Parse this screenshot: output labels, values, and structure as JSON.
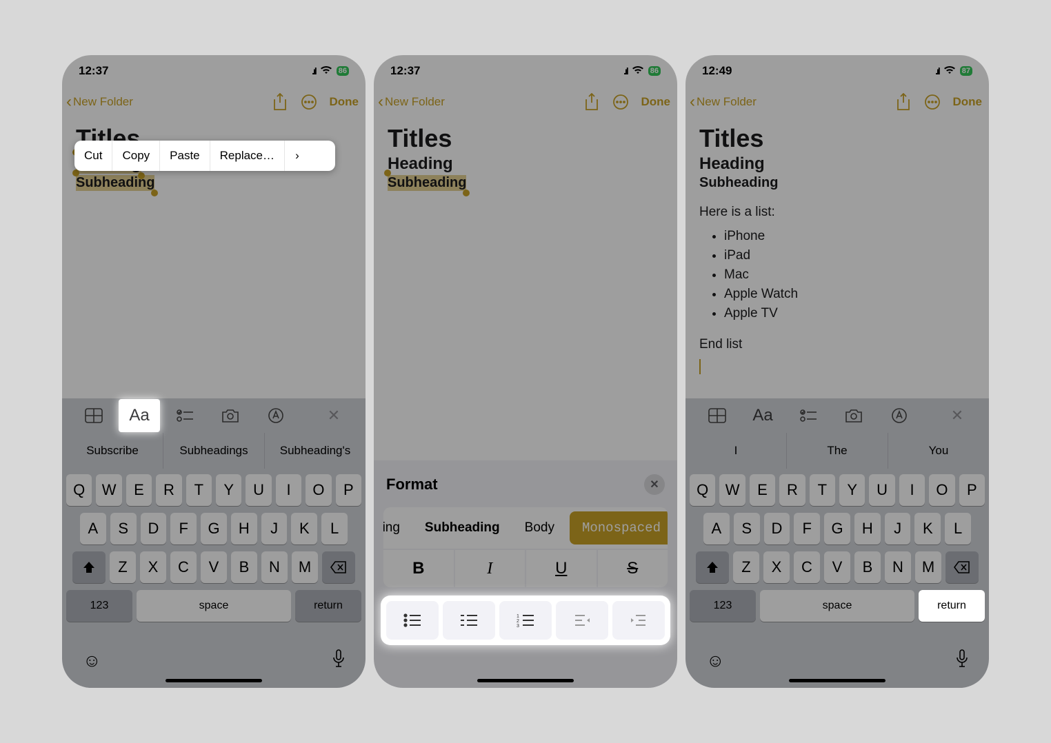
{
  "screens": [
    {
      "time": "12:37",
      "battery": "86",
      "back": "New Folder",
      "done": "Done",
      "note": {
        "title": "Titles",
        "heading": "Heading",
        "subheading": "Subheading"
      },
      "popover": [
        "Cut",
        "Copy",
        "Paste",
        "Replace…"
      ],
      "toolbar_highlight": "Aa",
      "suggestions": [
        "Subscribe",
        "Subheadings",
        "Subheading's"
      ],
      "keyboard": {
        "row1": [
          "Q",
          "W",
          "E",
          "R",
          "T",
          "Y",
          "U",
          "I",
          "O",
          "P"
        ],
        "row2": [
          "A",
          "S",
          "D",
          "F",
          "G",
          "H",
          "J",
          "K",
          "L"
        ],
        "row3": [
          "Z",
          "X",
          "C",
          "V",
          "B",
          "N",
          "M"
        ],
        "k123": "123",
        "space": "space",
        "ret": "return"
      }
    },
    {
      "time": "12:37",
      "battery": "86",
      "back": "New Folder",
      "done": "Done",
      "note": {
        "title": "Titles",
        "heading": "Heading",
        "subheading": "Subheading"
      },
      "format": {
        "header": "Format",
        "styles_visible": [
          "ding",
          "Subheading",
          "Body",
          "Monospaced"
        ],
        "biu": [
          "B",
          "I",
          "U",
          "S"
        ]
      }
    },
    {
      "time": "12:49",
      "battery": "87",
      "back": "New Folder",
      "done": "Done",
      "note": {
        "title": "Titles",
        "heading": "Heading",
        "subheading": "Subheading",
        "body_before": "Here is a list:",
        "bullets": [
          "iPhone",
          "iPad",
          "Mac",
          "Apple Watch",
          "Apple TV"
        ],
        "body_after": "End list"
      },
      "suggestions": [
        "I",
        "The",
        "You"
      ],
      "keyboard": {
        "row1": [
          "Q",
          "W",
          "E",
          "R",
          "T",
          "Y",
          "U",
          "I",
          "O",
          "P"
        ],
        "row2": [
          "A",
          "S",
          "D",
          "F",
          "G",
          "H",
          "J",
          "K",
          "L"
        ],
        "row3": [
          "Z",
          "X",
          "C",
          "V",
          "B",
          "N",
          "M"
        ],
        "k123": "123",
        "space": "space",
        "ret": "return"
      }
    }
  ],
  "colors": {
    "accent": "#c9a227"
  }
}
